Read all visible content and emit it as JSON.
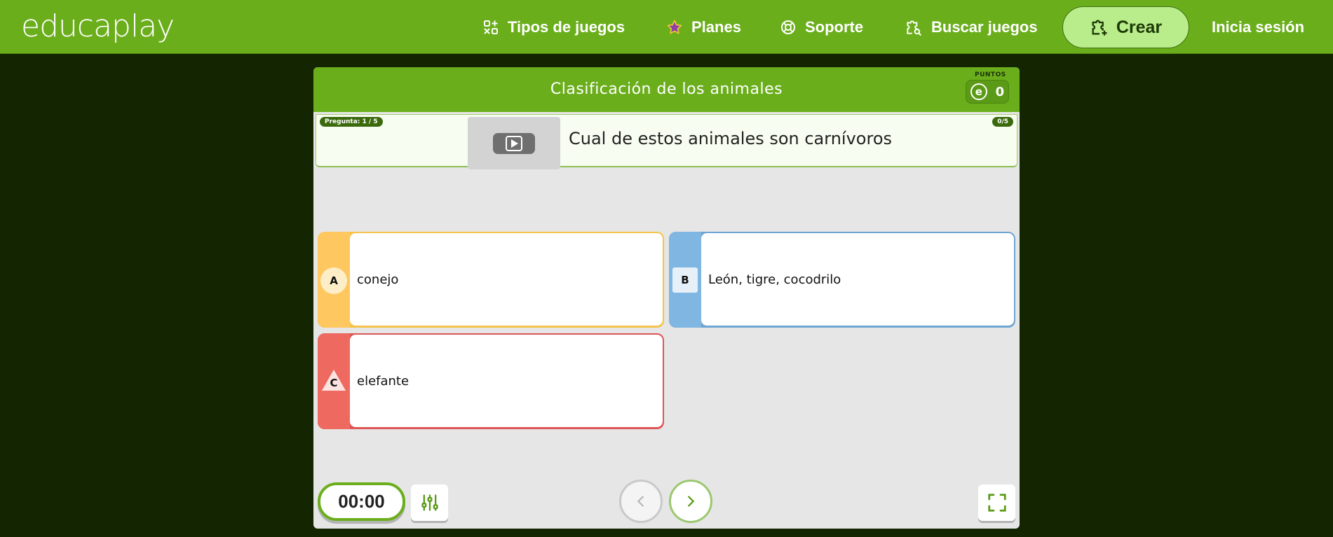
{
  "nav": {
    "logo_light": "educa",
    "logo_bold": "play",
    "items": [
      {
        "label": "Tipos de juegos",
        "icon": "game-types-icon"
      },
      {
        "label": "Planes",
        "icon": "star-icon"
      },
      {
        "label": "Soporte",
        "icon": "lifebuoy-icon"
      },
      {
        "label": "Buscar juegos",
        "icon": "search-puzzle-icon"
      }
    ],
    "create_label": "Crear",
    "login_label": "Inicia sesión"
  },
  "game": {
    "title": "Clasificación de los animales",
    "points_label": "PUNTOS",
    "points_coin": "e",
    "points_value": "0",
    "question_counter": "Pregunta: 1 / 5",
    "score_counter": "0/5",
    "question_text": "Cual de estos animales son carnívoros",
    "answers": [
      {
        "letter": "A",
        "text": "conejo"
      },
      {
        "letter": "B",
        "text": "León, tigre, cocodrilo"
      },
      {
        "letter": "C",
        "text": "elefante"
      }
    ],
    "timer": "00:00"
  },
  "colors": {
    "brand_green": "#6bae1c",
    "background": "#142502",
    "answer_a": "#fec760",
    "answer_b": "#7fb6e2",
    "answer_c": "#ee6a60"
  }
}
